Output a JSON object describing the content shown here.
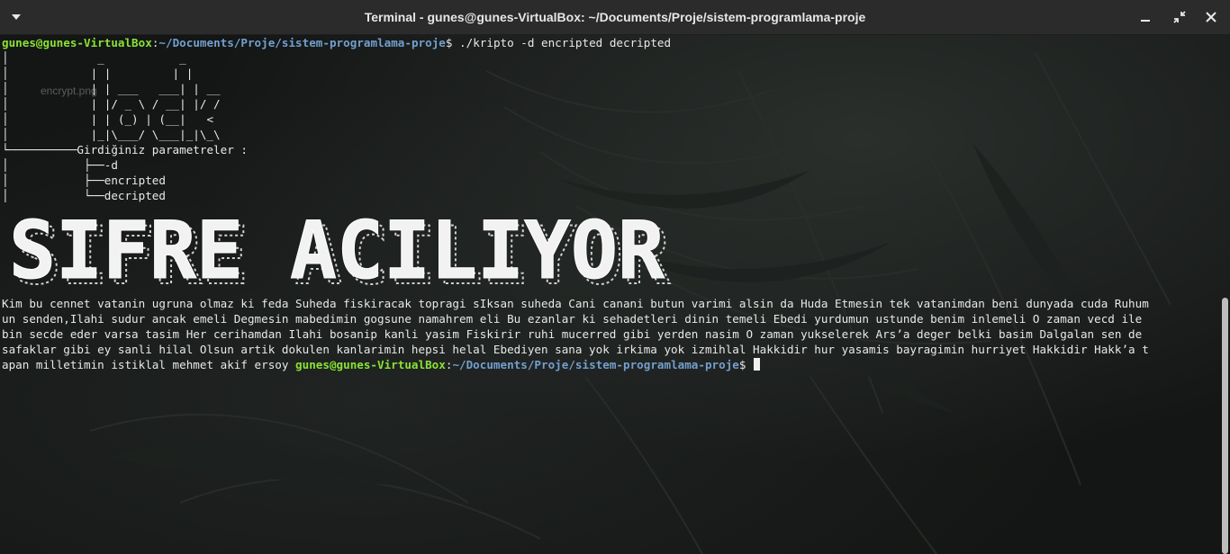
{
  "window": {
    "title": "Terminal - gunes@gunes-VirtualBox: ~/Documents/Proje/sistem-programlama-proje"
  },
  "desktop": {
    "file_label": "encrypt.png"
  },
  "prompt": {
    "user_host": "gunes@gunes-VirtualBox",
    "colon": ":",
    "path": "~/Documents/Proje/sistem-programlama-proje",
    "symbol": "$",
    "command": " ./kripto -d encripted decripted"
  },
  "output": {
    "ascii_logo": [
      "│             _           _",
      "│            | |         | |",
      "│            | | ___   ___| | __",
      "│            | |/ _ \\ / __| |/ /",
      "│            | | (_) | (__|   <",
      "│            |_|\\___/ \\___|_|\\_\\"
    ],
    "tree": [
      "└──────────Girdiğiniz parametreler :",
      "│           ├──-d",
      "│           ├──encripted",
      "│           └──decripted"
    ],
    "banner_text": "SIFRE ACILIYOR",
    "decrypted_text": [
      "Kim bu cennet vatanin ugruna olmaz ki feda Suheda fiskiracak topragi sIksan suheda Cani canani butun varimi alsin da Huda Etmesin tek vatanimdan beni dunyada cuda Ruhum",
      "un senden,Ilahi sudur ancak emeli Degmesin mabedimin gogsune namahrem eli Bu ezanlar ki sehadetleri dinin temeli Ebedi yurdumun ustunde benim inlemeli O zaman vecd ile",
      "bin secde eder varsa tasim Her cerihamdan Ilahi bosanip kanli yasim Fiskirir ruhi mucerred gibi yerden nasim O zaman yukselerek Ars’a deger belki basim Dalgalan sen de",
      "safaklar gibi ey sanli hilal Olsun artik dokulen kanlarimin hepsi helal Ebediyen sana yok irkima yok izmihlal Hakkidir hur yasamis bayragimin hurriyet Hakkidir Hakk’a t"
    ],
    "last_line_text": "apan milletimin istiklal mehmet akif ersoy "
  },
  "colors": {
    "prompt_user": "#8ae234",
    "prompt_path": "#729fcf",
    "text": "#e8e8e8",
    "background": "#141615"
  }
}
